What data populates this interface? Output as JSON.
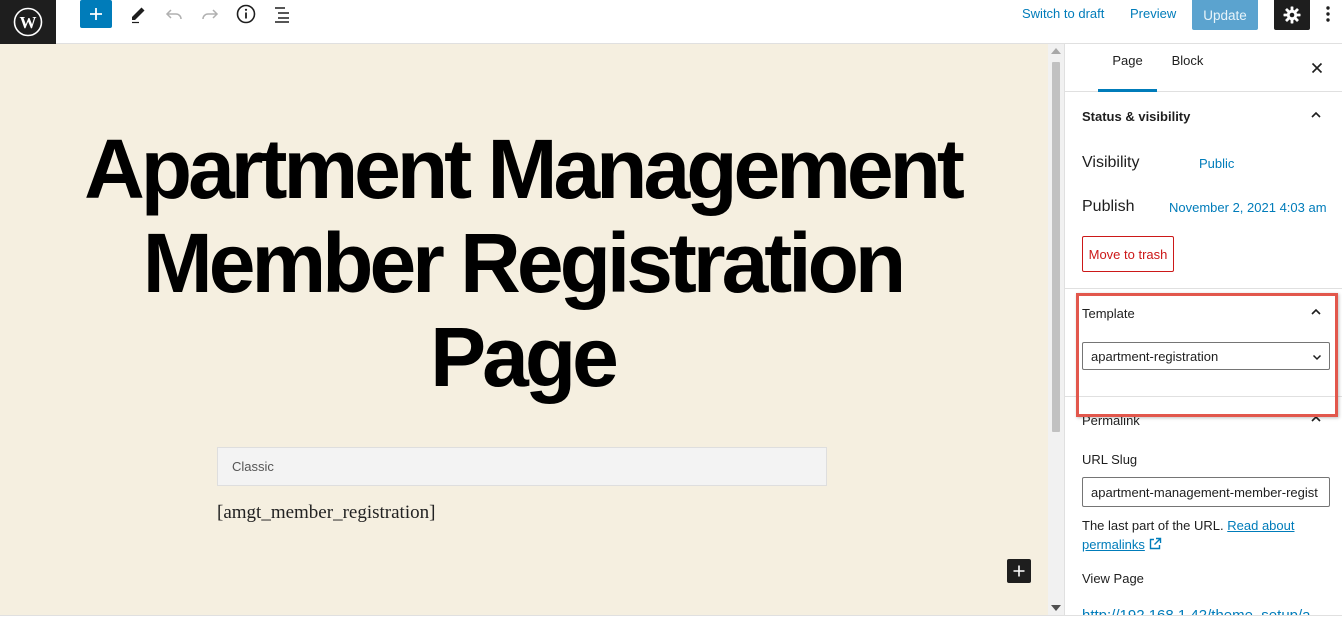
{
  "toolbar": {
    "logo_icon": "wordpress-logo-icon",
    "add_icon": "plus-icon",
    "tools_icon": "pencil-icon",
    "undo_icon": "undo-icon",
    "redo_icon": "redo-icon",
    "details_icon": "info-icon",
    "outline_icon": "list-view-icon",
    "switch_to_draft": "Switch to draft",
    "preview": "Preview",
    "update": "Update",
    "settings_icon": "gear-icon",
    "more_icon": "more-vertical-icon",
    "accent_color": "#007cba"
  },
  "editor": {
    "title_lines": [
      "Apartment Management",
      "Member Registration",
      "Page"
    ],
    "classic_block_label": "Classic",
    "shortcode": "[amgt_member_registration]",
    "background_color": "#f5efe0"
  },
  "sidebar": {
    "tabs": [
      {
        "label": "Page",
        "active": true
      },
      {
        "label": "Block",
        "active": false
      }
    ],
    "close_icon": "close-icon",
    "status": {
      "header": "Status & visibility",
      "visibility_label": "Visibility",
      "visibility_value": "Public",
      "publish_label": "Publish",
      "publish_value": "November 2, 2021 4:03 am",
      "trash_label": "Move to trash"
    },
    "template": {
      "header": "Template",
      "selected": "apartment-registration"
    },
    "permalink": {
      "header": "Permalink",
      "slug_label": "URL Slug",
      "slug_value": "apartment-management-member-regist",
      "help_text": "The last part of the URL.",
      "help_link": "Read about permalinks",
      "view_page_label": "View Page",
      "view_page_url": "http://192.168.1.42/theme_setup/a"
    }
  }
}
